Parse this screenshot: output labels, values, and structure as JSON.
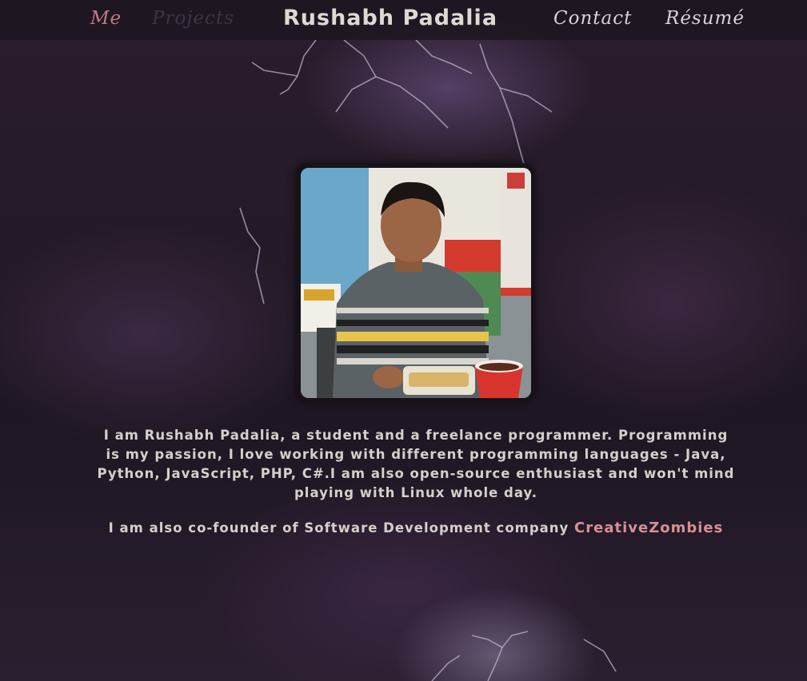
{
  "nav": {
    "me": "Me",
    "projects": "Projects",
    "title": "Rushabh Padalia",
    "contact": "Contact",
    "resume": "Résumé"
  },
  "profile": {
    "photo_icon": "profile-photo"
  },
  "bio": {
    "paragraph": "I am Rushabh Padalia, a student and a freelance programmer. Programming is my passion, I love working with different programming languages - Java, Python, JavaScript, PHP, C#.I am also open-source enthusiast and won't mind playing with Linux whole day.",
    "cofounder_prefix": "I am also co-founder of Software Development company ",
    "company_name": "CreativeZombies"
  },
  "colors": {
    "accent": "#c27a86",
    "link": "#d98f92",
    "text": "#d4d0ca",
    "nav_bg": "#1c1620"
  }
}
